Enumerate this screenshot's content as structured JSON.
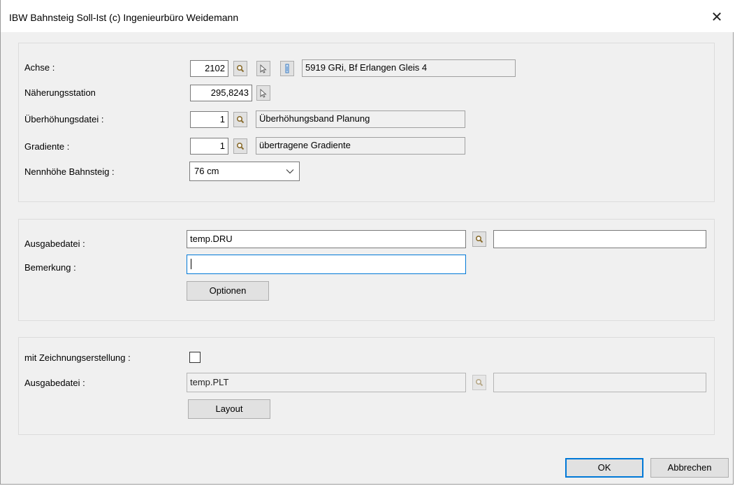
{
  "window": {
    "title": "IBW Bahnsteig Soll-Ist    (c) Ingenieurbüro Weidemann",
    "close_glyph": "✕"
  },
  "section1": {
    "achse": {
      "label": "Achse :",
      "number": "2102",
      "description": "5919 GRi, Bf Erlangen Gleis 4"
    },
    "naeherung": {
      "label": "Näherungsstation",
      "value": "295,8243"
    },
    "ueberhoehung": {
      "label": "Überhöhungsdatei :",
      "number": "1",
      "description": "Überhöhungsband  Planung"
    },
    "gradiente": {
      "label": "Gradiente :",
      "number": "1",
      "description": "übertragene Gradiente"
    },
    "nennhoehe": {
      "label": "Nennhöhe Bahnsteig :",
      "selected": "76 cm"
    }
  },
  "section2": {
    "ausgabe_label": "Ausgabedatei :",
    "ausgabe_value": "temp.DRU",
    "ausgabe_extra": "",
    "bemerkung_label": "Bemerkung :",
    "bemerkung_value": "",
    "optionen_button": "Optionen"
  },
  "section3": {
    "zeichnung_label": "mit Zeichnungserstellung :",
    "zeichnung_checked": false,
    "ausgabe_label": "Ausgabedatei :",
    "ausgabe_value": "temp.PLT",
    "ausgabe_extra": "",
    "layout_button": "Layout"
  },
  "footer": {
    "ok_button": "OK",
    "cancel_button": "Abbrechen"
  },
  "icons": [
    "search-icon",
    "pointer-icon",
    "info-icon",
    "chevron-down-icon",
    "close-icon"
  ],
  "colors": {
    "focus": "#0078d7",
    "dialog_bg": "#f0f0f0",
    "button_bg": "#e1e1e1"
  }
}
